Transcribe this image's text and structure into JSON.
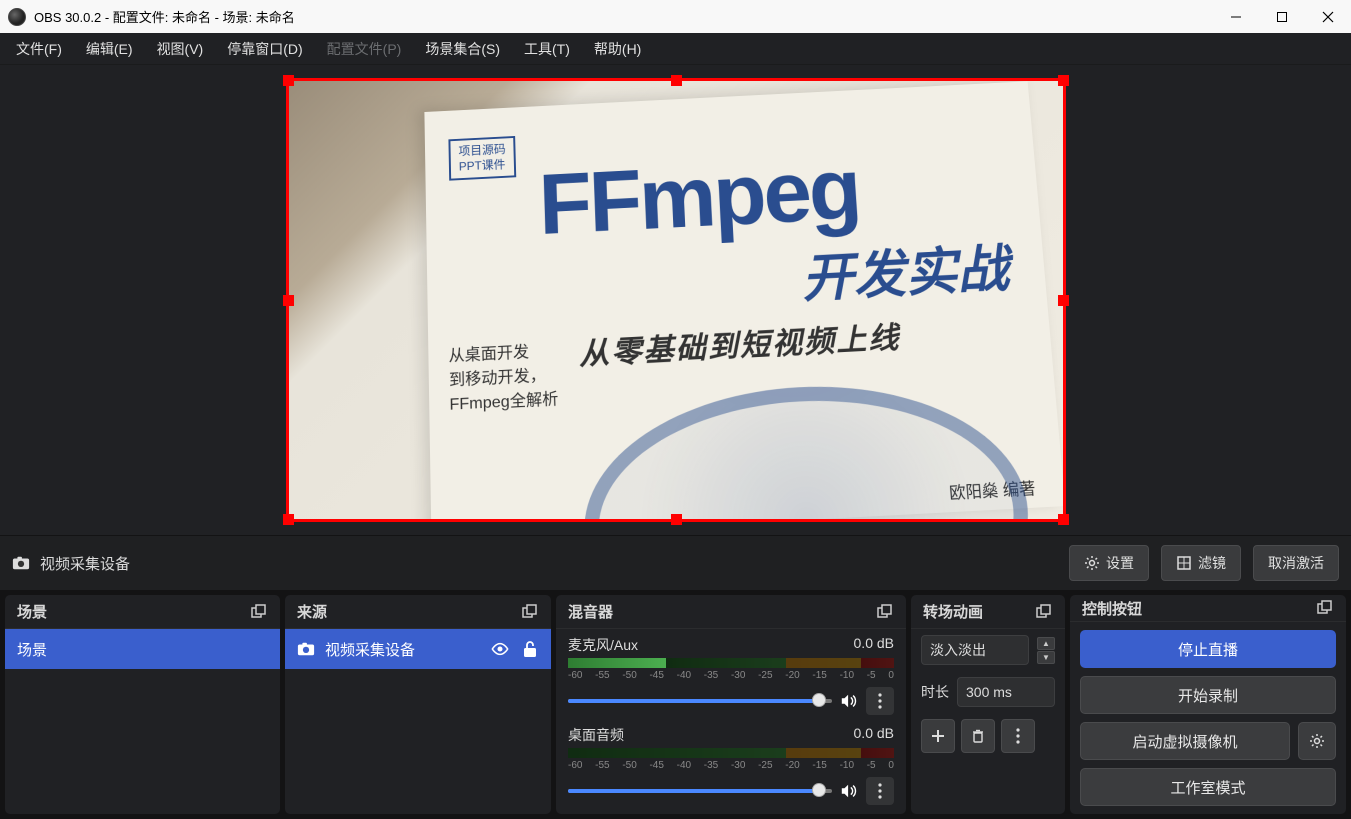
{
  "title": "OBS 30.0.2 - 配置文件: 未命名 - 场景: 未命名",
  "menus": {
    "file": "文件(F)",
    "edit": "编辑(E)",
    "view": "视图(V)",
    "docks": "停靠窗口(D)",
    "profile": "配置文件(P)",
    "sceneColl": "场景集合(S)",
    "tools": "工具(T)",
    "help": "帮助(H)"
  },
  "preview_book": {
    "badge_line1": "项目源码",
    "badge_line2": "PPT课件",
    "title": "FFmpeg",
    "subtitle": "开发实战",
    "subtitle2": "从零基础到短视频上线",
    "left_line1": "从桌面开发",
    "left_line2": "到移动开发，",
    "left_line3": "FFmpeg全解析",
    "author": "欧阳燊  编著"
  },
  "source_toolbar": {
    "label": "视频采集设备",
    "settings": "设置",
    "filters": "滤镜",
    "deactivate": "取消激活"
  },
  "panels": {
    "scenes": {
      "title": "场景",
      "item": "场景"
    },
    "sources": {
      "title": "来源",
      "item": "视频采集设备"
    },
    "mixer": {
      "title": "混音器",
      "ch1": {
        "name": "麦克风/Aux",
        "level": "0.0 dB"
      },
      "ch2": {
        "name": "桌面音频",
        "level": "0.0 dB"
      },
      "ticks": [
        "-60",
        "-55",
        "-50",
        "-45",
        "-40",
        "-35",
        "-30",
        "-25",
        "-20",
        "-15",
        "-10",
        "-5",
        "0"
      ]
    },
    "transitions": {
      "title": "转场动画",
      "type": "淡入淡出",
      "duration_label": "时长",
      "duration": "300 ms"
    },
    "controls": {
      "title": "控制按钮",
      "stop_stream": "停止直播",
      "start_rec": "开始录制",
      "start_vcam": "启动虚拟摄像机",
      "studio": "工作室模式"
    }
  }
}
